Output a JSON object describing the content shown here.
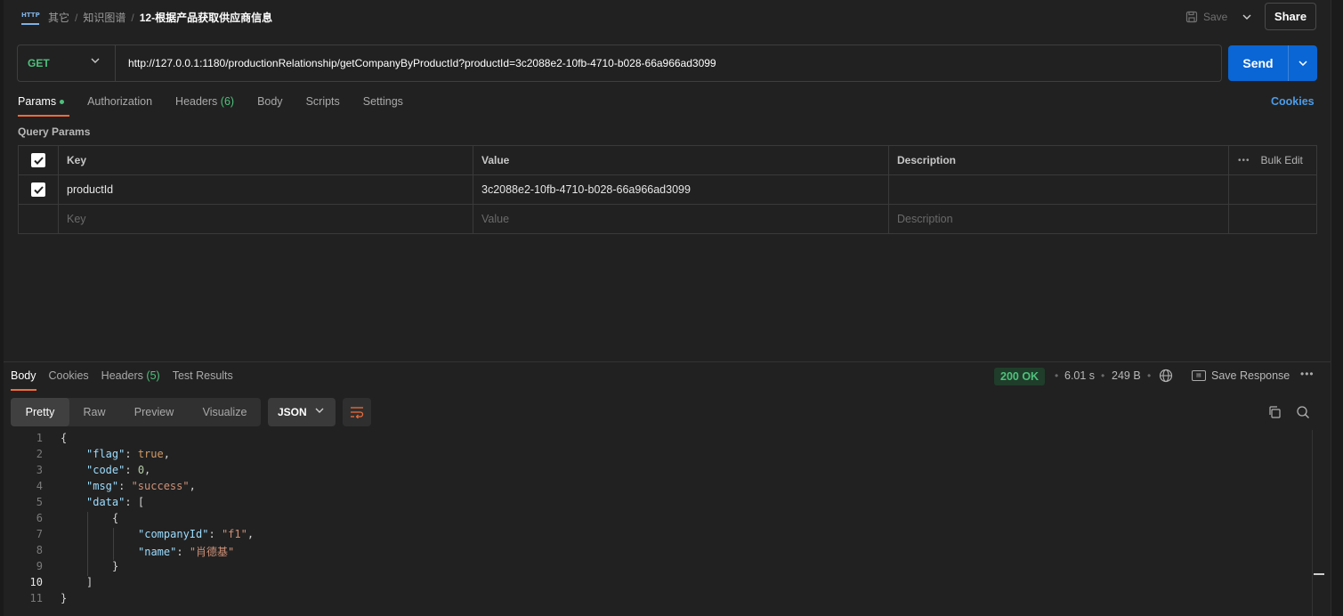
{
  "header": {
    "protocol_icon": "http-icon",
    "breadcrumbs": [
      "其它",
      "知识图谱"
    ],
    "separator": "/",
    "current": "12-根据产品获取供应商信息",
    "save_label": "Save",
    "share_label": "Share"
  },
  "request": {
    "method": "GET",
    "url": "http://127.0.0.1:1180/productionRelationship/getCompanyByProductId?productId=3c2088e2-10fb-4710-b028-66a966ad3099",
    "send_label": "Send"
  },
  "request_tabs": {
    "params": "Params",
    "authorization": "Authorization",
    "headers": "Headers",
    "headers_count": "(6)",
    "body": "Body",
    "scripts": "Scripts",
    "settings": "Settings",
    "cookies": "Cookies"
  },
  "query_params": {
    "title": "Query Params",
    "columns": {
      "key": "Key",
      "value": "Value",
      "description": "Description",
      "bulk_edit": "Bulk Edit"
    },
    "rows": [
      {
        "checked": true,
        "key": "productId",
        "value": "3c2088e2-10fb-4710-b028-66a966ad3099",
        "description": ""
      }
    ],
    "placeholders": {
      "key": "Key",
      "value": "Value",
      "description": "Description"
    }
  },
  "response": {
    "tabs": {
      "body": "Body",
      "cookies": "Cookies",
      "headers": "Headers",
      "headers_count": "(5)",
      "test_results": "Test Results"
    },
    "status": "200 OK",
    "time": "6.01 s",
    "size": "249 B",
    "save_response": "Save Response",
    "views": [
      "Pretty",
      "Raw",
      "Preview",
      "Visualize"
    ],
    "active_view": "Pretty",
    "format": "JSON"
  },
  "code": {
    "line_numbers": [
      "1",
      "2",
      "3",
      "4",
      "5",
      "6",
      "7",
      "8",
      "9",
      "10",
      "11"
    ],
    "brace_open": "{",
    "brace_close": "}",
    "bracket_open": "[",
    "bracket_close": "]",
    "colon": ": ",
    "comma": ",",
    "flag_key": "\"flag\"",
    "flag_value": "true",
    "code_key": "\"code\"",
    "code_value": "0",
    "msg_key": "\"msg\"",
    "msg_value": "\"success\"",
    "data_key": "\"data\"",
    "company_key": "\"companyId\"",
    "company_value": "\"f1\"",
    "name_key": "\"name\"",
    "name_value": "\"肖德基\""
  },
  "colors": {
    "accent_orange": "#f26b3a",
    "send_blue": "#0a66d4",
    "success_green": "#4fc07c",
    "link_blue": "#4d9ce8"
  }
}
